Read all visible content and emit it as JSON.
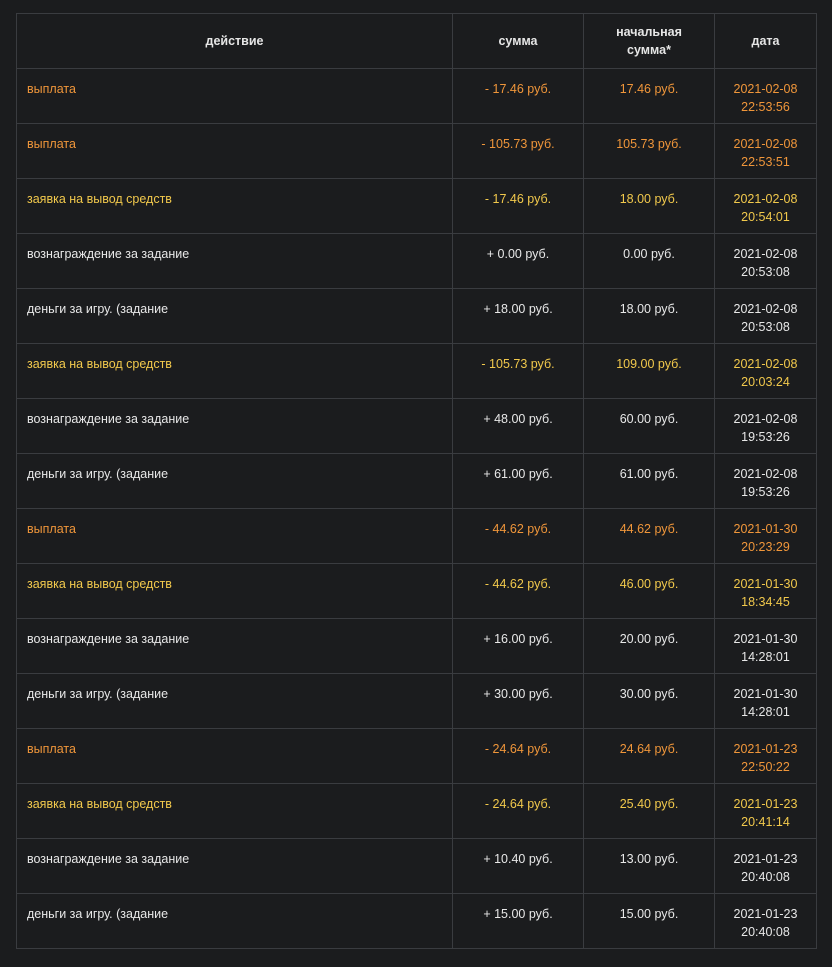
{
  "header": {
    "action": "действие",
    "amount": "сумма",
    "initial_amount_line1": "начальная",
    "initial_amount_line2": "сумма*",
    "date": "дата"
  },
  "colors": {
    "payout": "#f0963a",
    "request": "#f2c94c",
    "income": "#e8e8e8",
    "background": "#1b1c1e",
    "border": "#3a3c40"
  },
  "rows": [
    {
      "type": "payout",
      "action": "выплата",
      "amount": "- 17.46 руб.",
      "initial": "17.46 руб.",
      "date": "2021-02-08",
      "time": "22:53:56"
    },
    {
      "type": "payout",
      "action": "выплата",
      "amount": "- 105.73 руб.",
      "initial": "105.73 руб.",
      "date": "2021-02-08",
      "time": "22:53:51"
    },
    {
      "type": "request",
      "action": "заявка на вывод средств",
      "amount": "- 17.46 руб.",
      "initial": "18.00 руб.",
      "date": "2021-02-08",
      "time": "20:54:01"
    },
    {
      "type": "income",
      "action": "вознаграждение за задание",
      "amount": "+ 0.00 руб.",
      "initial": "0.00 руб.",
      "date": "2021-02-08",
      "time": "20:53:08"
    },
    {
      "type": "income",
      "action": "деньги за игру. (задание",
      "amount": "+ 18.00 руб.",
      "initial": "18.00 руб.",
      "date": "2021-02-08",
      "time": "20:53:08"
    },
    {
      "type": "request",
      "action": "заявка на вывод средств",
      "amount": "- 105.73 руб.",
      "initial": "109.00 руб.",
      "date": "2021-02-08",
      "time": "20:03:24"
    },
    {
      "type": "income",
      "action": "вознаграждение за задание",
      "amount": "+ 48.00 руб.",
      "initial": "60.00 руб.",
      "date": "2021-02-08",
      "time": "19:53:26"
    },
    {
      "type": "income",
      "action": "деньги за игру. (задание",
      "amount": "+ 61.00 руб.",
      "initial": "61.00 руб.",
      "date": "2021-02-08",
      "time": "19:53:26"
    },
    {
      "type": "payout",
      "action": "выплата",
      "amount": "- 44.62 руб.",
      "initial": "44.62 руб.",
      "date": "2021-01-30",
      "time": "20:23:29"
    },
    {
      "type": "request",
      "action": "заявка на вывод средств",
      "amount": "- 44.62 руб.",
      "initial": "46.00 руб.",
      "date": "2021-01-30",
      "time": "18:34:45"
    },
    {
      "type": "income",
      "action": "вознаграждение за задание",
      "amount": "+ 16.00 руб.",
      "initial": "20.00 руб.",
      "date": "2021-01-30",
      "time": "14:28:01"
    },
    {
      "type": "income",
      "action": "деньги за игру. (задание",
      "amount": "+ 30.00 руб.",
      "initial": "30.00 руб.",
      "date": "2021-01-30",
      "time": "14:28:01"
    },
    {
      "type": "payout",
      "action": "выплата",
      "amount": "- 24.64 руб.",
      "initial": "24.64 руб.",
      "date": "2021-01-23",
      "time": "22:50:22"
    },
    {
      "type": "request",
      "action": "заявка на вывод средств",
      "amount": "- 24.64 руб.",
      "initial": "25.40 руб.",
      "date": "2021-01-23",
      "time": "20:41:14"
    },
    {
      "type": "income",
      "action": "вознаграждение за задание",
      "amount": "+ 10.40 руб.",
      "initial": "13.00 руб.",
      "date": "2021-01-23",
      "time": "20:40:08"
    },
    {
      "type": "income",
      "action": "деньги за игру. (задание",
      "amount": "+ 15.00 руб.",
      "initial": "15.00 руб.",
      "date": "2021-01-23",
      "time": "20:40:08"
    }
  ]
}
